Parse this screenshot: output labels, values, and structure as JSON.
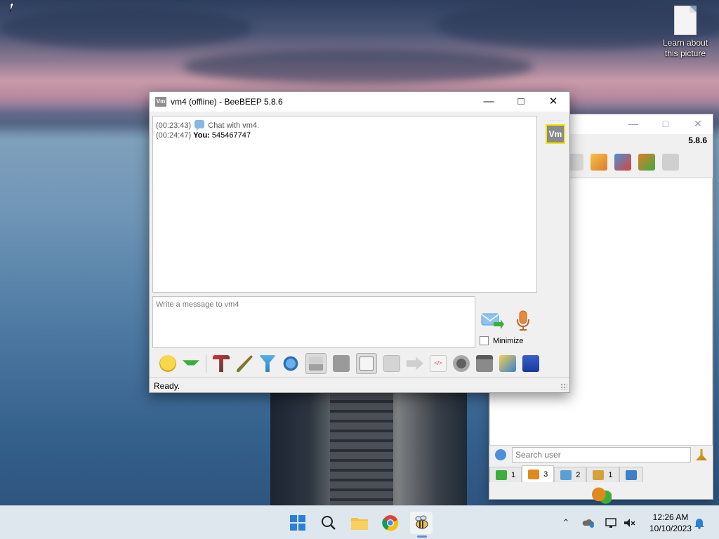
{
  "desktop": {
    "icons": [
      {
        "label": "Learn about this picture",
        "icon": "file-icon"
      }
    ]
  },
  "background_window": {
    "version": "5.8.6",
    "search": {
      "placeholder": "Search user",
      "value": ""
    },
    "tabs": [
      {
        "count": "1",
        "icon": "chat-tab-icon",
        "color": "#3dae3d"
      },
      {
        "count": "3",
        "icon": "users-tab-icon",
        "color": "#e08a1e"
      },
      {
        "count": "2",
        "icon": "groups-tab-icon",
        "color": "#5aa0d8"
      },
      {
        "count": "1",
        "icon": "network-tab-icon",
        "color": "#d8a03a"
      },
      {
        "count": "",
        "icon": "share-tab-icon",
        "color": "#3d7fc9"
      }
    ]
  },
  "chat_window": {
    "title": "vm4 (offline) - BeeBEEP 5.8.6",
    "title_icon": "Vm",
    "avatar_label": "Vm",
    "messages": [
      {
        "time": "(00:23:43)",
        "sender": "",
        "text": "Chat with vm4."
      },
      {
        "time": "(00:24:47)",
        "sender": "You:",
        "text": "545467747"
      }
    ],
    "input": {
      "placeholder": "Write a message to vm4",
      "value": ""
    },
    "minimize_label": "Minimize",
    "status": "Ready."
  },
  "taskbar": {
    "clock_time": "12:26 AM",
    "clock_date": "10/10/2023"
  },
  "colors": {
    "accent": "#5b8fcf",
    "avatar_border": "#f2e600",
    "avatar_bg": "#8a8a8a"
  }
}
